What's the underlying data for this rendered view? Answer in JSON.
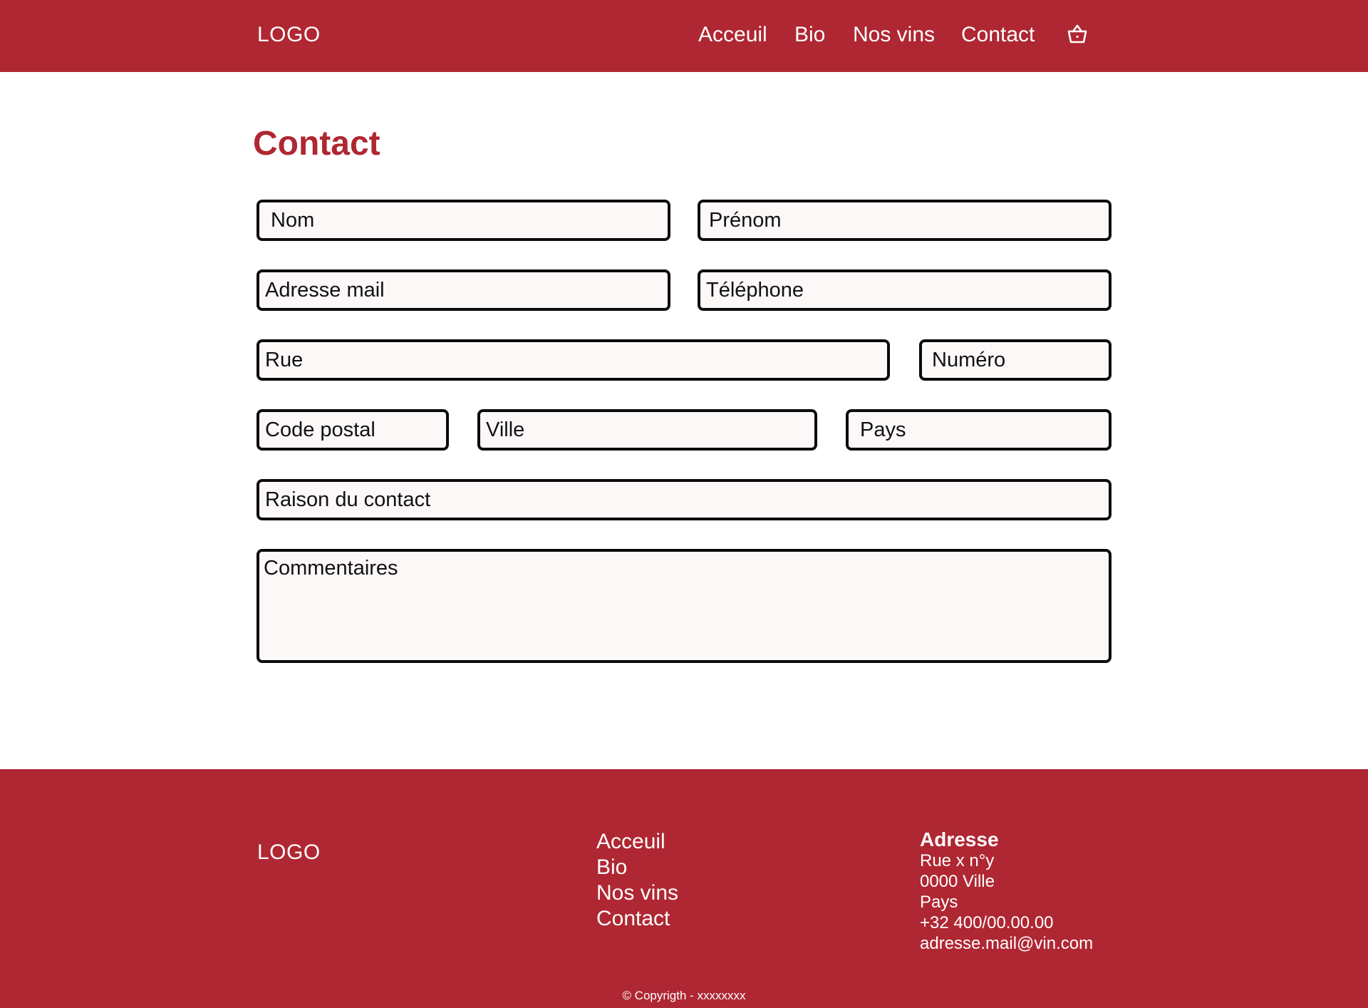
{
  "header": {
    "logo": "LOGO",
    "nav": [
      "Acceuil",
      "Bio",
      "Nos vins",
      "Contact"
    ],
    "cart_icon": "shopping-basket-icon"
  },
  "main": {
    "title": "Contact",
    "form": {
      "nom": "Nom",
      "prenom": "Prénom",
      "email": "Adresse mail",
      "telephone": "Téléphone",
      "rue": "Rue",
      "numero": "Numéro",
      "code_postal": "Code postal",
      "ville": "Ville",
      "pays": "Pays",
      "raison": "Raison du contact",
      "commentaires": "Commentaires"
    }
  },
  "footer": {
    "logo": "LOGO",
    "nav": [
      "Acceuil",
      "Bio",
      "Nos vins",
      "Contact"
    ],
    "address": {
      "title": "Adresse",
      "street": "Rue x n°y",
      "city": "0000 Ville",
      "country": "Pays",
      "phone": "+32 400/00.00.00",
      "email": "adresse.mail@vin.com"
    },
    "copyright": "© Copyrigth - xxxxxxxx"
  },
  "colors": {
    "brand": "#af2732",
    "field_bg": "#fbf8f7",
    "border": "#0b0b0b"
  }
}
